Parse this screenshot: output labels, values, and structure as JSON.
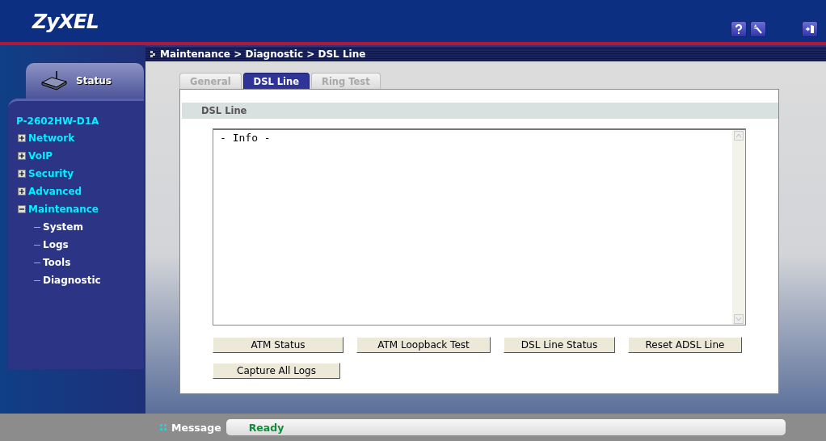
{
  "header": {
    "logo": "ZyXEL"
  },
  "sidebar": {
    "status_tab": "Status",
    "device": "P-2602HW-D1A",
    "tree": [
      {
        "label": "Network",
        "expanded": false
      },
      {
        "label": "VoIP",
        "expanded": false
      },
      {
        "label": "Security",
        "expanded": false
      },
      {
        "label": "Advanced",
        "expanded": false
      },
      {
        "label": "Maintenance",
        "expanded": true,
        "children": [
          {
            "label": "System"
          },
          {
            "label": "Logs"
          },
          {
            "label": "Tools"
          },
          {
            "label": "Diagnostic"
          }
        ]
      }
    ]
  },
  "breadcrumb": "Maintenance > Diagnostic > DSL Line",
  "tabs": [
    {
      "label": "General",
      "selected": false
    },
    {
      "label": "DSL Line",
      "selected": true
    },
    {
      "label": "Ring Test",
      "selected": false
    }
  ],
  "section_title": "DSL Line",
  "info_box": {
    "value": "- Info -"
  },
  "buttons": [
    [
      "ATM Status",
      "ATM Loopback Test",
      "DSL Line Status",
      "Reset ADSL Line"
    ],
    [
      "Capture All Logs"
    ]
  ],
  "status_bar": {
    "label": "Message",
    "value": "Ready"
  }
}
